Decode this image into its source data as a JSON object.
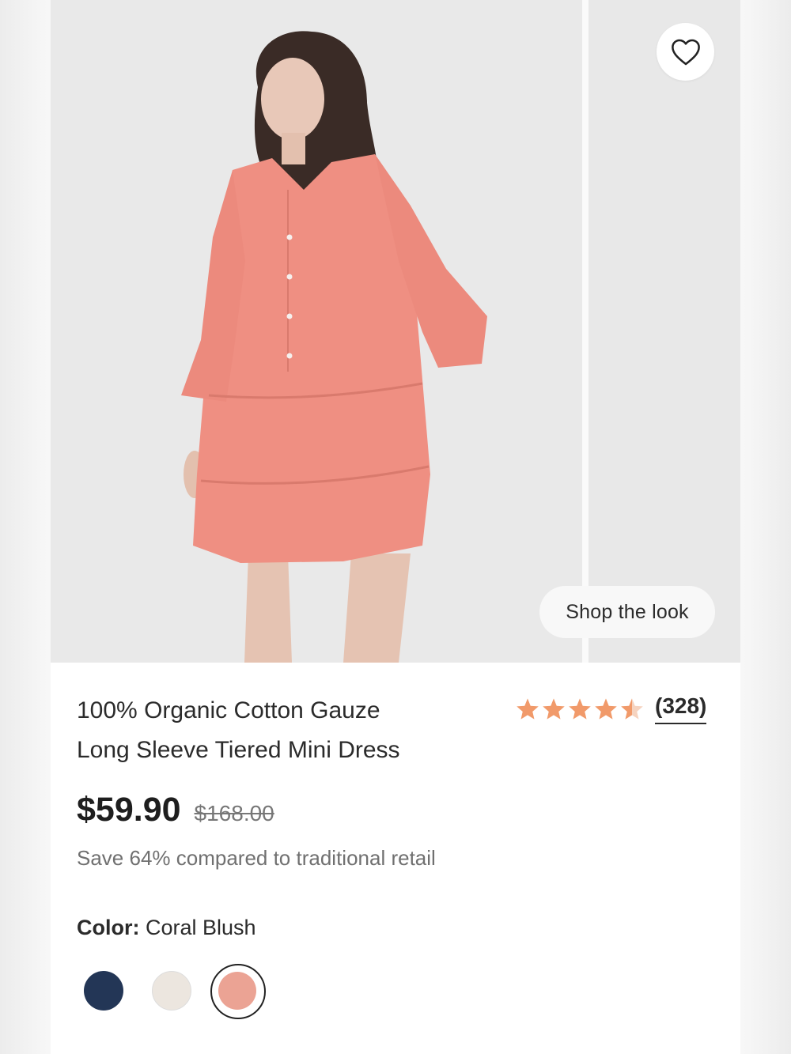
{
  "gallery": {
    "shop_the_look": "Shop the look"
  },
  "product": {
    "title_line1": "100% Organic Cotton Gauze",
    "title_line2": "Long Sleeve Tiered Mini Dress",
    "rating": 4.5,
    "review_count": "(328)",
    "price": "$59.90",
    "original_price": "$168.00",
    "savings": "Save 64% compared to traditional retail",
    "color_label": "Color:",
    "color_value": "Coral Blush"
  },
  "swatches": [
    {
      "name": "navy",
      "color": "#233656"
    },
    {
      "name": "cream",
      "color": "#ece6df"
    },
    {
      "name": "coral",
      "color": "#eba394",
      "selected": true
    }
  ],
  "colors": {
    "star": "#f19a6a",
    "text": "#2b2b2b"
  },
  "icons": [
    "heart-icon",
    "star-icon"
  ]
}
